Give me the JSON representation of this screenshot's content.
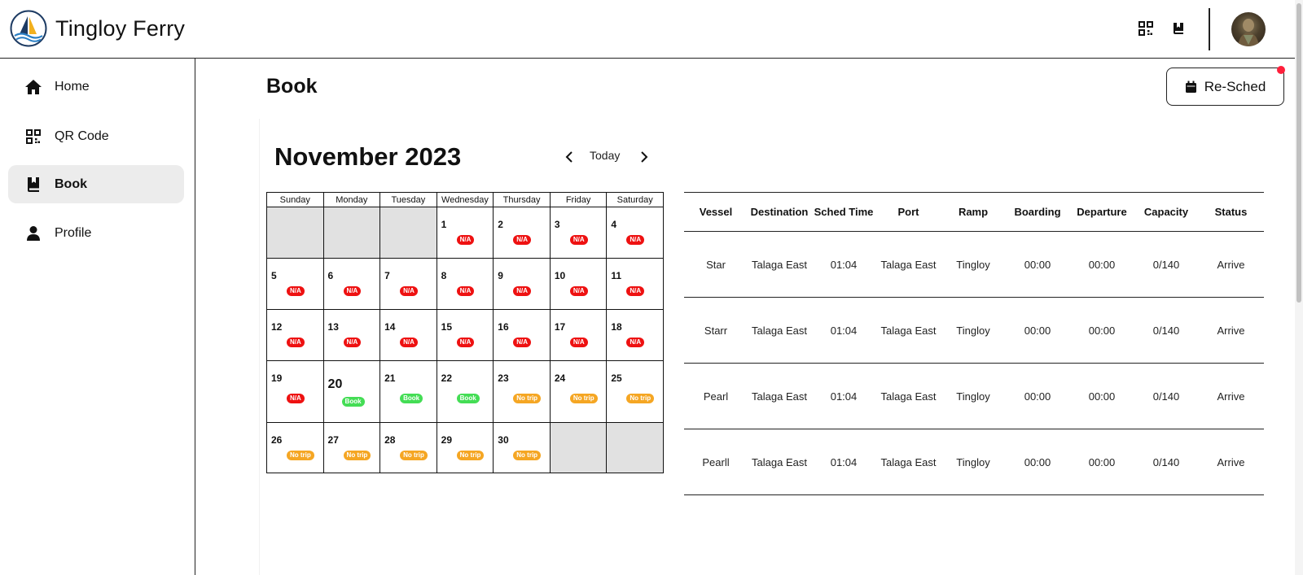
{
  "app": {
    "name": "Tingloy Ferry"
  },
  "header": {
    "icons": [
      "qr-code-icon",
      "bookmark-book-icon"
    ],
    "avatar": "user-avatar"
  },
  "sidebar": {
    "items": [
      {
        "label": "Home",
        "icon": "home-icon",
        "active": false
      },
      {
        "label": "QR Code",
        "icon": "qr-code-icon",
        "active": false
      },
      {
        "label": "Book",
        "icon": "book-icon",
        "active": true
      },
      {
        "label": "Profile",
        "icon": "person-icon",
        "active": false
      }
    ]
  },
  "page": {
    "title": "Book",
    "resched_label": "Re-Sched"
  },
  "calendar": {
    "month_label": "November 2023",
    "today_label": "Today",
    "weekdays": [
      "Sunday",
      "Monday",
      "Tuesday",
      "Wednesday",
      "Thursday",
      "Friday",
      "Saturday"
    ],
    "weeks": [
      [
        null,
        null,
        null,
        {
          "day": "1",
          "status": "N/A"
        },
        {
          "day": "2",
          "status": "N/A"
        },
        {
          "day": "3",
          "status": "N/A"
        },
        {
          "day": "4",
          "status": "N/A"
        }
      ],
      [
        {
          "day": "5",
          "status": "N/A"
        },
        {
          "day": "6",
          "status": "N/A"
        },
        {
          "day": "7",
          "status": "N/A"
        },
        {
          "day": "8",
          "status": "N/A"
        },
        {
          "day": "9",
          "status": "N/A"
        },
        {
          "day": "10",
          "status": "N/A"
        },
        {
          "day": "11",
          "status": "N/A"
        }
      ],
      [
        {
          "day": "12",
          "status": "N/A"
        },
        {
          "day": "13",
          "status": "N/A"
        },
        {
          "day": "14",
          "status": "N/A"
        },
        {
          "day": "15",
          "status": "N/A"
        },
        {
          "day": "16",
          "status": "N/A"
        },
        {
          "day": "17",
          "status": "N/A"
        },
        {
          "day": "18",
          "status": "N/A"
        }
      ],
      [
        {
          "day": "19",
          "status": "N/A"
        },
        {
          "day": "20",
          "status": "Book",
          "today": true
        },
        {
          "day": "21",
          "status": "Book"
        },
        {
          "day": "22",
          "status": "Book"
        },
        {
          "day": "23",
          "status": "No trip"
        },
        {
          "day": "24",
          "status": "No trip"
        },
        {
          "day": "25",
          "status": "No trip"
        }
      ],
      [
        {
          "day": "26",
          "status": "No trip"
        },
        {
          "day": "27",
          "status": "No trip"
        },
        {
          "day": "28",
          "status": "No trip"
        },
        {
          "day": "29",
          "status": "No trip"
        },
        {
          "day": "30",
          "status": "No trip"
        },
        null,
        null
      ]
    ],
    "status_colors": {
      "N/A": "#ee1111",
      "Book": "#44dd55",
      "No trip": "#f5a623"
    }
  },
  "schedule": {
    "columns": [
      "Vessel",
      "Destination",
      "Sched Time",
      "Port",
      "Ramp",
      "Boarding",
      "Departure",
      "Capacity",
      "Status"
    ],
    "rows": [
      [
        "Star",
        "Talaga East",
        "01:04",
        "Talaga East",
        "Tingloy",
        "00:00",
        "00:00",
        "0/140",
        "Arrive"
      ],
      [
        "Starr",
        "Talaga East",
        "01:04",
        "Talaga East",
        "Tingloy",
        "00:00",
        "00:00",
        "0/140",
        "Arrive"
      ],
      [
        "Pearl",
        "Talaga East",
        "01:04",
        "Talaga East",
        "Tingloy",
        "00:00",
        "00:00",
        "0/140",
        "Arrive"
      ],
      [
        "Pearll",
        "Talaga East",
        "01:04",
        "Talaga East",
        "Tingloy",
        "00:00",
        "00:00",
        "0/140",
        "Arrive"
      ]
    ]
  }
}
